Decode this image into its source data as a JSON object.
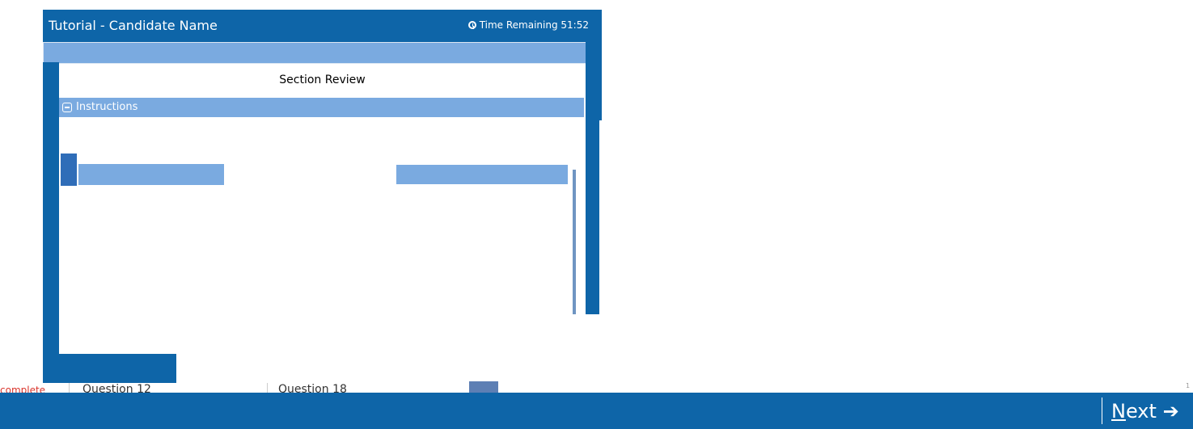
{
  "window": {
    "title": "Tutorial - Candidate Name",
    "timer": "Time Remaining 51:52"
  },
  "panel": {
    "title": "Section Review",
    "instructions_label": "Instructions"
  },
  "status": {
    "left_text": "complete",
    "items": [
      "Question 12",
      "Question 18"
    ],
    "page_indicator": "1"
  },
  "navigation": {
    "next_first": "N",
    "next_rest": "ext",
    "next_arrow": "➔"
  },
  "colors": {
    "brand_blue": "#0e65a8",
    "light_blue": "#7aaae0",
    "warning_red": "#d9342b"
  }
}
